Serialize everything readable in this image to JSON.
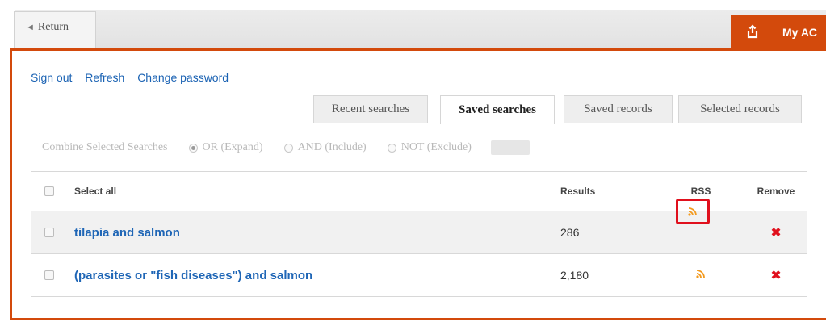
{
  "topbar": {
    "return_label": "Return",
    "myac_label": "My AC"
  },
  "links": {
    "sign_out": "Sign out",
    "refresh": "Refresh",
    "change_password": "Change password"
  },
  "tabs": [
    {
      "label": "Recent searches",
      "active": false
    },
    {
      "label": "Saved searches",
      "active": true
    },
    {
      "label": "Saved records",
      "active": false
    },
    {
      "label": "Selected records",
      "active": false
    }
  ],
  "combine": {
    "label": "Combine Selected Searches",
    "or_label": "OR (Expand)",
    "and_label": "AND (Include)",
    "not_label": "NOT (Exclude)",
    "selected": "OR"
  },
  "table": {
    "headers": {
      "select_all": "Select all",
      "results": "Results",
      "rss": "RSS",
      "remove": "Remove"
    },
    "rows": [
      {
        "query": "tilapia and salmon",
        "results": "286"
      },
      {
        "query": "(parasites or \"fish diseases\") and salmon",
        "results": "2,180"
      }
    ]
  },
  "colors": {
    "accent": "#d34a0c",
    "link": "#1f66b6",
    "remove": "#e0101d",
    "rss": "#f39a1e",
    "highlight": "#e0101d"
  },
  "icons": {
    "return": "left-arrow-icon",
    "myac": "export-icon",
    "rss": "rss-icon",
    "remove": "close-icon"
  }
}
